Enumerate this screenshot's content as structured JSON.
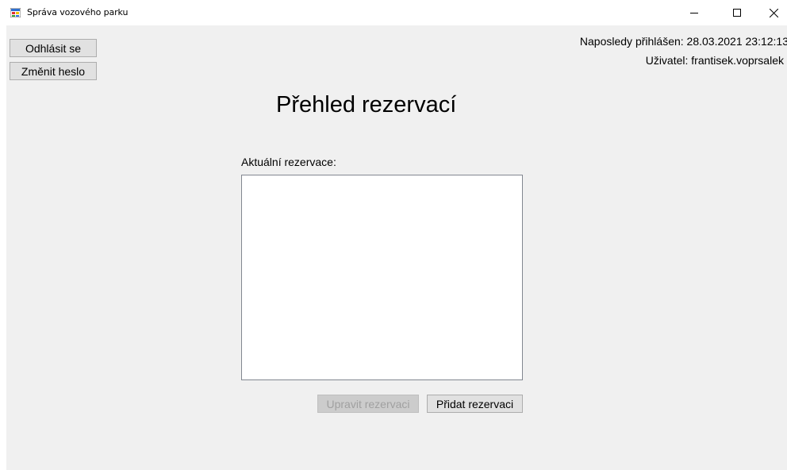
{
  "window": {
    "title": "Správa vozového parku",
    "icon": "app-forms-icon",
    "controls": {
      "minimize_icon": "minimize-icon",
      "maximize_icon": "maximize-icon",
      "close_icon": "close-icon"
    }
  },
  "toolbar": {
    "logout_label": "Odhlásit se",
    "change_password_label": "Změnit heslo"
  },
  "session": {
    "last_login": "Naposledy přihlášen: 28.03.2021 23:12:13",
    "user": "Uživatel: frantisek.voprsalek"
  },
  "main": {
    "title": "Přehled rezervací",
    "list_label": "Aktuální rezervace:",
    "reservations": [],
    "edit_label": "Upravit rezervaci",
    "edit_enabled": false,
    "add_label": "Přidat rezervaci"
  },
  "colors": {
    "client_background": "#f0f0f0",
    "button_background": "#e1e1e1",
    "button_border": "#adadad",
    "disabled_text": "#a0a0a0"
  }
}
